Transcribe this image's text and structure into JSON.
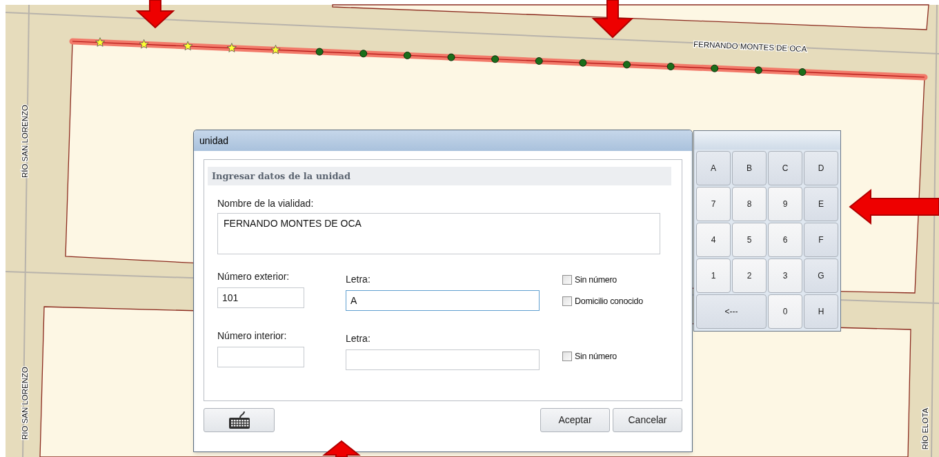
{
  "map": {
    "street_labels": [
      {
        "text": "FERNANDO MONTES DE OCA"
      },
      {
        "text": "RÍO SAN LORENZO"
      },
      {
        "text": "RIO SAN LORENZO"
      },
      {
        "text": "RÍO ELOTA"
      }
    ],
    "route_markers": [
      {
        "kind": "star"
      },
      {
        "kind": "star"
      },
      {
        "kind": "star"
      },
      {
        "kind": "star"
      },
      {
        "kind": "star"
      },
      {
        "kind": "dot"
      },
      {
        "kind": "dot"
      },
      {
        "kind": "dot"
      },
      {
        "kind": "dot"
      },
      {
        "kind": "dot"
      },
      {
        "kind": "dot"
      },
      {
        "kind": "dot"
      },
      {
        "kind": "dot"
      },
      {
        "kind": "dot"
      },
      {
        "kind": "dot"
      },
      {
        "kind": "dot"
      },
      {
        "kind": "dot"
      }
    ]
  },
  "dialog": {
    "title": "unidad",
    "section_title": "Ingresar datos de la unidad",
    "street_name": {
      "label": "Nombre de la vialidad:",
      "value": "FERNANDO MONTES DE OCA",
      "focused": false
    },
    "rows": [
      {
        "number_label": "Número exterior:",
        "number_value": "101",
        "number_focused": false,
        "letter_label": "Letra:",
        "letter_value": "A",
        "letter_focused": true,
        "checkboxes": [
          {
            "label": "Sin número",
            "checked": false
          },
          {
            "label": "Domicilio conocido",
            "checked": false
          }
        ]
      },
      {
        "number_label": "Número interior:",
        "number_value": "",
        "number_focused": false,
        "letter_label": "Letra:",
        "letter_value": "",
        "letter_focused": false,
        "checkboxes": [
          {
            "label": "Sin número",
            "checked": false
          }
        ]
      }
    ],
    "buttons": [
      {
        "kind": "keyboard"
      },
      {
        "kind": "text",
        "label": "Aceptar"
      },
      {
        "kind": "text",
        "label": "Cancelar"
      }
    ]
  },
  "keypad": {
    "keys": [
      {
        "label": "A",
        "kind": "letter"
      },
      {
        "label": "B",
        "kind": "letter"
      },
      {
        "label": "C",
        "kind": "letter"
      },
      {
        "label": "D",
        "kind": "letter"
      },
      {
        "label": "7",
        "kind": "digit"
      },
      {
        "label": "8",
        "kind": "digit"
      },
      {
        "label": "9",
        "kind": "digit"
      },
      {
        "label": "E",
        "kind": "letter"
      },
      {
        "label": "4",
        "kind": "digit"
      },
      {
        "label": "5",
        "kind": "digit"
      },
      {
        "label": "6",
        "kind": "digit"
      },
      {
        "label": "F",
        "kind": "letter"
      },
      {
        "label": "1",
        "kind": "digit"
      },
      {
        "label": "2",
        "kind": "digit"
      },
      {
        "label": "3",
        "kind": "digit"
      },
      {
        "label": "G",
        "kind": "letter"
      },
      {
        "label": "<---",
        "kind": "backspace"
      },
      {
        "label": "0",
        "kind": "digit"
      },
      {
        "label": "H",
        "kind": "letter"
      }
    ]
  }
}
